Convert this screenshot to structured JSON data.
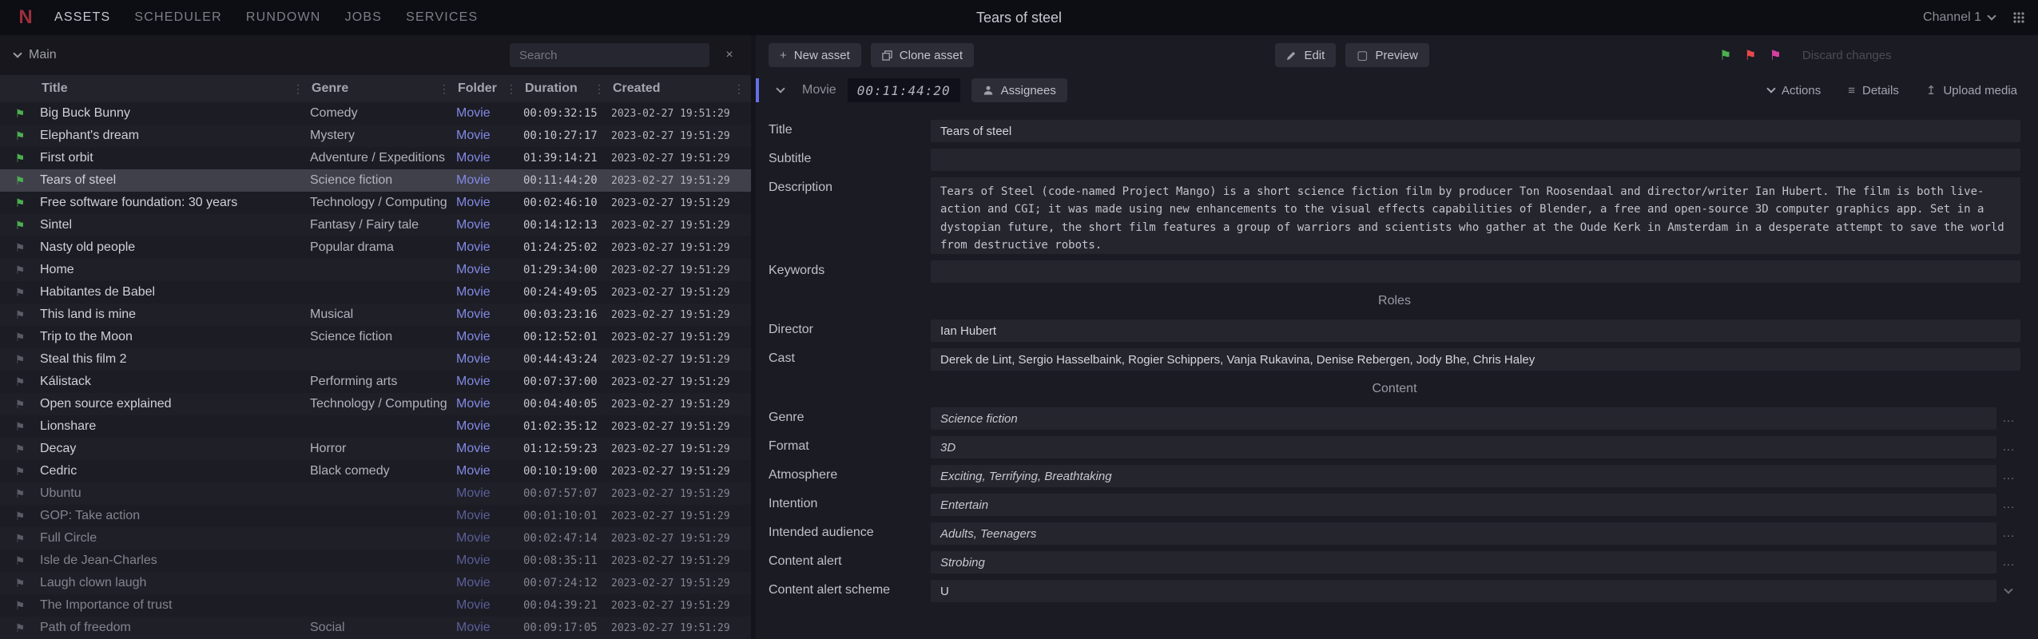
{
  "topbar": {
    "logo_text": "N",
    "menu": [
      "ASSETS",
      "SCHEDULER",
      "RUNDOWN",
      "JOBS",
      "SERVICES"
    ],
    "title": "Tears of steel",
    "channel": "Channel 1"
  },
  "browser": {
    "view_label": "Main",
    "search_placeholder": "Search",
    "columns": [
      "Title",
      "Genre",
      "Folder",
      "Duration",
      "Created"
    ],
    "rows": [
      {
        "title": "Big Buck Bunny",
        "genre": "Comedy",
        "folder": "Movie",
        "duration": "00:09:32:15",
        "created": "2023-02-27 19:51:29",
        "flag": "green"
      },
      {
        "title": "Elephant's dream",
        "genre": "Mystery",
        "folder": "Movie",
        "duration": "00:10:27:17",
        "created": "2023-02-27 19:51:29",
        "flag": "green"
      },
      {
        "title": "First orbit",
        "genre": "Adventure / Expeditions",
        "folder": "Movie",
        "duration": "01:39:14:21",
        "created": "2023-02-27 19:51:29",
        "flag": "green"
      },
      {
        "title": "Tears of steel",
        "genre": "Science fiction",
        "folder": "Movie",
        "duration": "00:11:44:20",
        "created": "2023-02-27 19:51:29",
        "flag": "green",
        "selected": true
      },
      {
        "title": "Free software foundation: 30 years",
        "genre": "Technology / Computing",
        "folder": "Movie",
        "duration": "00:02:46:10",
        "created": "2023-02-27 19:51:29",
        "flag": "green"
      },
      {
        "title": "Sintel",
        "genre": "Fantasy / Fairy tale",
        "folder": "Movie",
        "duration": "00:14:12:13",
        "created": "2023-02-27 19:51:29",
        "flag": "green"
      },
      {
        "title": "Nasty old people",
        "genre": "Popular drama",
        "folder": "Movie",
        "duration": "01:24:25:02",
        "created": "2023-02-27 19:51:29",
        "flag": "gray"
      },
      {
        "title": "Home",
        "genre": "",
        "folder": "Movie",
        "duration": "01:29:34:00",
        "created": "2023-02-27 19:51:29",
        "flag": "gray"
      },
      {
        "title": "Habitantes de Babel",
        "genre": "",
        "folder": "Movie",
        "duration": "00:24:49:05",
        "created": "2023-02-27 19:51:29",
        "flag": "gray"
      },
      {
        "title": "This land is mine",
        "genre": "Musical",
        "folder": "Movie",
        "duration": "00:03:23:16",
        "created": "2023-02-27 19:51:29",
        "flag": "gray"
      },
      {
        "title": "Trip to the Moon",
        "genre": "Science fiction",
        "folder": "Movie",
        "duration": "00:12:52:01",
        "created": "2023-02-27 19:51:29",
        "flag": "gray"
      },
      {
        "title": "Steal this film 2",
        "genre": "",
        "folder": "Movie",
        "duration": "00:44:43:24",
        "created": "2023-02-27 19:51:29",
        "flag": "gray"
      },
      {
        "title": "Kálistack",
        "genre": "Performing arts",
        "folder": "Movie",
        "duration": "00:07:37:00",
        "created": "2023-02-27 19:51:29",
        "flag": "gray"
      },
      {
        "title": "Open source explained",
        "genre": "Technology / Computing",
        "folder": "Movie",
        "duration": "00:04:40:05",
        "created": "2023-02-27 19:51:29",
        "flag": "gray"
      },
      {
        "title": "Lionshare",
        "genre": "",
        "folder": "Movie",
        "duration": "01:02:35:12",
        "created": "2023-02-27 19:51:29",
        "flag": "gray"
      },
      {
        "title": "Decay",
        "genre": "Horror",
        "folder": "Movie",
        "duration": "01:12:59:23",
        "created": "2023-02-27 19:51:29",
        "flag": "gray"
      },
      {
        "title": "Cedric",
        "genre": "Black comedy",
        "folder": "Movie",
        "duration": "00:10:19:00",
        "created": "2023-02-27 19:51:29",
        "flag": "gray"
      },
      {
        "title": "Ubuntu",
        "genre": "",
        "folder": "Movie",
        "duration": "00:07:57:07",
        "created": "2023-02-27 19:51:29",
        "flag": "gray",
        "dim": true
      },
      {
        "title": "GOP: Take action",
        "genre": "",
        "folder": "Movie",
        "duration": "00:01:10:01",
        "created": "2023-02-27 19:51:29",
        "flag": "gray",
        "dim": true
      },
      {
        "title": "Full Circle",
        "genre": "",
        "folder": "Movie",
        "duration": "00:02:47:14",
        "created": "2023-02-27 19:51:29",
        "flag": "gray",
        "dim": true
      },
      {
        "title": "Isle de Jean-Charles",
        "genre": "",
        "folder": "Movie",
        "duration": "00:08:35:11",
        "created": "2023-02-27 19:51:29",
        "flag": "gray",
        "dim": true
      },
      {
        "title": "Laugh clown laugh",
        "genre": "",
        "folder": "Movie",
        "duration": "00:07:24:12",
        "created": "2023-02-27 19:51:29",
        "flag": "gray",
        "dim": true
      },
      {
        "title": "The Importance of trust",
        "genre": "",
        "folder": "Movie",
        "duration": "00:04:39:21",
        "created": "2023-02-27 19:51:29",
        "flag": "gray",
        "dim": true
      },
      {
        "title": "Path of freedom",
        "genre": "Social",
        "folder": "Movie",
        "duration": "00:09:17:05",
        "created": "2023-02-27 19:51:29",
        "flag": "gray",
        "dim": true
      }
    ]
  },
  "detail": {
    "toolbar": {
      "new_asset": "New asset",
      "clone_asset": "Clone asset",
      "edit": "Edit",
      "preview": "Preview",
      "discard": "Discard changes"
    },
    "subtoolbar": {
      "type": "Movie",
      "timecode": "00:11:44:20",
      "assignees": "Assignees",
      "actions": "Actions",
      "details": "Details",
      "upload": "Upload media"
    },
    "form": [
      {
        "type": "field",
        "label": "Title",
        "value": "Tears of steel",
        "kind": "text"
      },
      {
        "type": "field",
        "label": "Subtitle",
        "value": "",
        "kind": "text"
      },
      {
        "type": "field",
        "label": "Description",
        "value": "Tears of Steel (code-named Project Mango) is a short science fiction film by producer Ton Roosendaal and director/writer Ian Hubert. The film is both live-action and CGI; it was made using new enhancements to the visual effects capabilities of Blender, a free and open-source 3D computer graphics app. Set in a dystopian future, the short film features a group of warriors and scientists who gather at the Oude Kerk in Amsterdam in a desperate attempt to save the world from destructive robots.",
        "kind": "textarea"
      },
      {
        "type": "field",
        "label": "Keywords",
        "value": "",
        "kind": "text"
      },
      {
        "type": "section",
        "label": "Roles"
      },
      {
        "type": "field",
        "label": "Director",
        "value": "Ian Hubert",
        "kind": "text"
      },
      {
        "type": "field",
        "label": "Cast",
        "value": "Derek de Lint, Sergio Hasselbaink, Rogier Schippers, Vanja Rukavina, Denise Rebergen, Jody Bhe, Chris Haley",
        "kind": "text"
      },
      {
        "type": "section",
        "label": "Content"
      },
      {
        "type": "field",
        "label": "Genre",
        "value": "Science fiction",
        "kind": "select"
      },
      {
        "type": "field",
        "label": "Format",
        "value": "3D",
        "kind": "select"
      },
      {
        "type": "field",
        "label": "Atmosphere",
        "value": "Exciting, Terrifying, Breathtaking",
        "kind": "select"
      },
      {
        "type": "field",
        "label": "Intention",
        "value": "Entertain",
        "kind": "select"
      },
      {
        "type": "field",
        "label": "Intended audience",
        "value": "Adults, Teenagers",
        "kind": "select"
      },
      {
        "type": "field",
        "label": "Content alert",
        "value": "Strobing",
        "kind": "select"
      },
      {
        "type": "field",
        "label": "Content alert scheme",
        "value": "U",
        "kind": "dropdown"
      }
    ]
  },
  "icons": {
    "flag": "⚑",
    "more": "…",
    "column_menu": "⋮",
    "plus": "+",
    "preview": "▢",
    "details": "≡",
    "upload": "↥",
    "clear": "×"
  },
  "colors": {
    "accent": "#8289e4",
    "accent_bar": "#6570e8",
    "flag_green": "#4caf50",
    "flag_gray": "#5c5c66",
    "flag_red": "#e5484d",
    "flag_pink": "#d6409f",
    "selected_row": "#40404b"
  }
}
